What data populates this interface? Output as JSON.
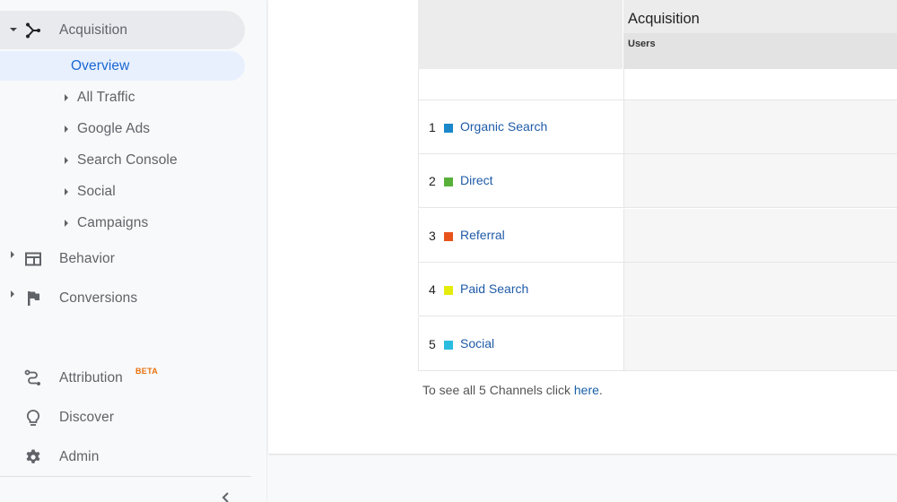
{
  "sidebar": {
    "acquisition": {
      "label": "Acquisition",
      "expanded": true
    },
    "sub_items": [
      {
        "label": "Overview",
        "active": true
      },
      {
        "label": "All Traffic"
      },
      {
        "label": "Google Ads"
      },
      {
        "label": "Search Console"
      },
      {
        "label": "Social"
      },
      {
        "label": "Campaigns"
      }
    ],
    "behavior": {
      "label": "Behavior"
    },
    "conversions": {
      "label": "Conversions"
    },
    "attribution": {
      "label": "Attribution",
      "badge": "BETA"
    },
    "discover": {
      "label": "Discover"
    },
    "admin": {
      "label": "Admin"
    },
    "collapse_icon": "chevron-left"
  },
  "table": {
    "group_header": "Acquisition",
    "column_header": "Users",
    "rows": [
      {
        "rank": "1",
        "channel": "Organic Search",
        "color": "#1a87c9"
      },
      {
        "rank": "2",
        "channel": "Direct",
        "color": "#58b03b"
      },
      {
        "rank": "3",
        "channel": "Referral",
        "color": "#e8531c"
      },
      {
        "rank": "4",
        "channel": "Paid Search",
        "color": "#e5ec0c"
      },
      {
        "rank": "5",
        "channel": "Social",
        "color": "#2bbde0"
      }
    ],
    "footnote_prefix": "To see all 5 Channels click ",
    "footnote_link": "here",
    "footnote_suffix": "."
  }
}
